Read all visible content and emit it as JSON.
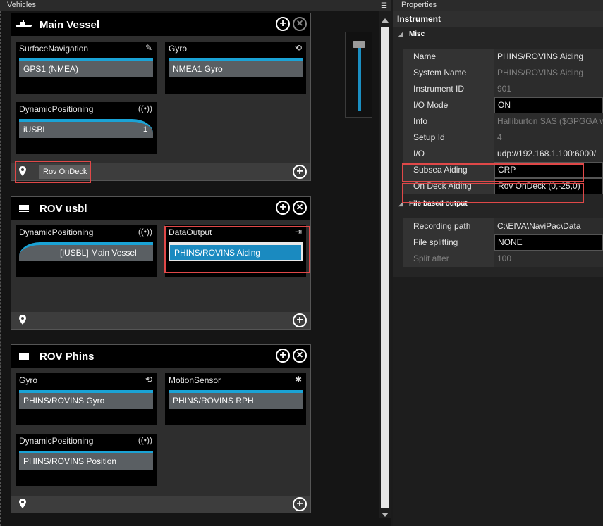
{
  "vehicles_panel": {
    "title": "Vehicles"
  },
  "properties_panel": {
    "title": "Properties"
  },
  "vehicles": [
    {
      "name": "Main Vessel",
      "slots": [
        {
          "label": "SurfaceNavigation",
          "icon": "satellite-icon",
          "item": "GPS1 (NMEA)"
        },
        {
          "label": "Gyro",
          "icon": "gyro-icon",
          "item": "NMEA1 Gyro"
        },
        {
          "label": "DynamicPositioning",
          "icon": "signal-icon",
          "item": "iUSBL",
          "badge": "1"
        }
      ],
      "location": "Rov OnDeck"
    },
    {
      "name": "ROV usbl",
      "slots": [
        {
          "label": "DynamicPositioning",
          "icon": "signal-icon",
          "item": "[iUSBL] Main Vessel"
        },
        {
          "label": "DataOutput",
          "icon": "output-icon",
          "item": "PHINS/ROVINS Aiding"
        }
      ]
    },
    {
      "name": "ROV Phins",
      "slots": [
        {
          "label": "Gyro",
          "icon": "gyro-icon",
          "item": "PHINS/ROVINS Gyro"
        },
        {
          "label": "MotionSensor",
          "icon": "motion-icon",
          "item": "PHINS/ROVINS RPH"
        },
        {
          "label": "DynamicPositioning",
          "icon": "signal-icon",
          "item": "PHINS/ROVINS Position"
        }
      ]
    }
  ],
  "properties": {
    "section": "Instrument",
    "misc_label": "Misc",
    "misc": [
      {
        "name": "Name",
        "value": "PHINS/ROVINS Aiding"
      },
      {
        "name": "System Name",
        "value": "PHINS/ROVINS Aiding"
      },
      {
        "name": "Instrument ID",
        "value": "901"
      },
      {
        "name": "I/O Mode",
        "value": "ON"
      },
      {
        "name": "Info",
        "value": "Halliburton SAS ($GPGGA wh"
      },
      {
        "name": "Setup Id",
        "value": "4"
      },
      {
        "name": "I/O",
        "value": "udp://192.168.1.100:6000/"
      },
      {
        "name": "Subsea Aiding",
        "value": "CRP"
      },
      {
        "name": "On Deck Aiding",
        "value": "Rov OnDeck (0,-25,0)"
      }
    ],
    "file_label": "File based output",
    "file": [
      {
        "name": "Recording path",
        "value": "C:\\EIVA\\NaviPac\\Data"
      },
      {
        "name": "File splitting",
        "value": "NONE"
      },
      {
        "name": "Split after",
        "value": "100"
      }
    ]
  }
}
